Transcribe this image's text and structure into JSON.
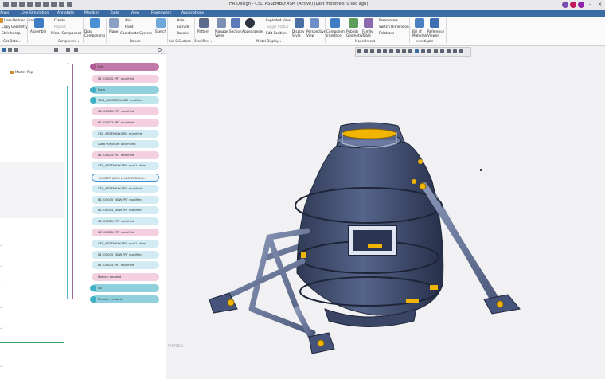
{
  "window": {
    "title": "HR Design - CSL_ASSEMBLY.ASM (Active) (Last modified: 0 sec ago)"
  },
  "tabs": [
    "Apps",
    "Live Simulation",
    "Annotate",
    "Manikin",
    "Tools",
    "View",
    "Framework",
    "Applications"
  ],
  "ribbon": {
    "items": {
      "user_defined": "User-Defined Feature",
      "copy_geometry": "Copy Geometry",
      "shrinkwrap": "Shrinkwrap",
      "assemble": "Assemble",
      "create": "Create",
      "repeat": "Repeat",
      "mirror_component": "Mirror Component",
      "drag_components": "Drag Components",
      "plane": "Plane",
      "axis": "Axis",
      "point": "Point",
      "coordinate_system": "Coordinate System",
      "sketch": "Sketch",
      "hole": "Hole",
      "extrude": "Extrude",
      "revolve": "Revolve",
      "pattern": "Pattern",
      "manage_views": "Manage Views",
      "section": "Section",
      "appearances": "Appearances",
      "exploded_view": "Exploded View",
      "toggle_status": "Toggle Status",
      "edit_position": "Edit Position",
      "display_style": "Display Style",
      "perspective_view": "Perspective View",
      "component_interface": "Component Interface",
      "publish_geometry": "Publish Geometry",
      "family_table": "Family Table",
      "parameters": "Parameters",
      "switch_dimensions": "Switch Dimensions",
      "relations": "Relations",
      "bill_of_materials": "Bill of Materials",
      "reference_viewer": "Reference Viewer"
    },
    "groups": {
      "get_data": "Get Data ▾",
      "component": "Component ▾",
      "datum": "Datum ▾",
      "cut_surface": "Cut & Surface ▾",
      "modifiers": "Modifiers ▾",
      "model_display": "Model Display ▾",
      "model_intent": "Model Intent ▾",
      "investigate": "Investigate ▾"
    }
  },
  "left_panel": {
    "tree_root": "Master Rep"
  },
  "timeline": {
    "items": [
      "tire",
      "61100825.PRT modified",
      "Main",
      "GEN_ASSEMBLY.ASM modified",
      "61100823.PRT modified",
      "61100823.PRT modified",
      "CSL_ASSEMBLY.ASM modified",
      "Data structure optimized",
      "61100825.PRT modified",
      "CSL_ASSEMBLY.ASM and 1 other...",
      "SHUSTPH/ZH+LH-BODY-COLO...",
      "CSL_ASSEMBLY.ASM modified",
      "61100005_NEW.PRT modified",
      "61100005_NEW.PRT modified",
      "61100825.PRT modified",
      "61100825.PRT modified",
      "CSL_ASSEMBLY.ASM and 1 other...",
      "61100005_NEW.PRT modified",
      "61100825.PRT modified",
      "Branch created",
      "V4",
      "Session created"
    ]
  },
  "viewport": {
    "watermark": "PARTDESI"
  },
  "colors": {
    "ribbon_tab": "#3b6ba5",
    "model_body": "#3d4a66",
    "accent_yellow": "#f1b400"
  }
}
